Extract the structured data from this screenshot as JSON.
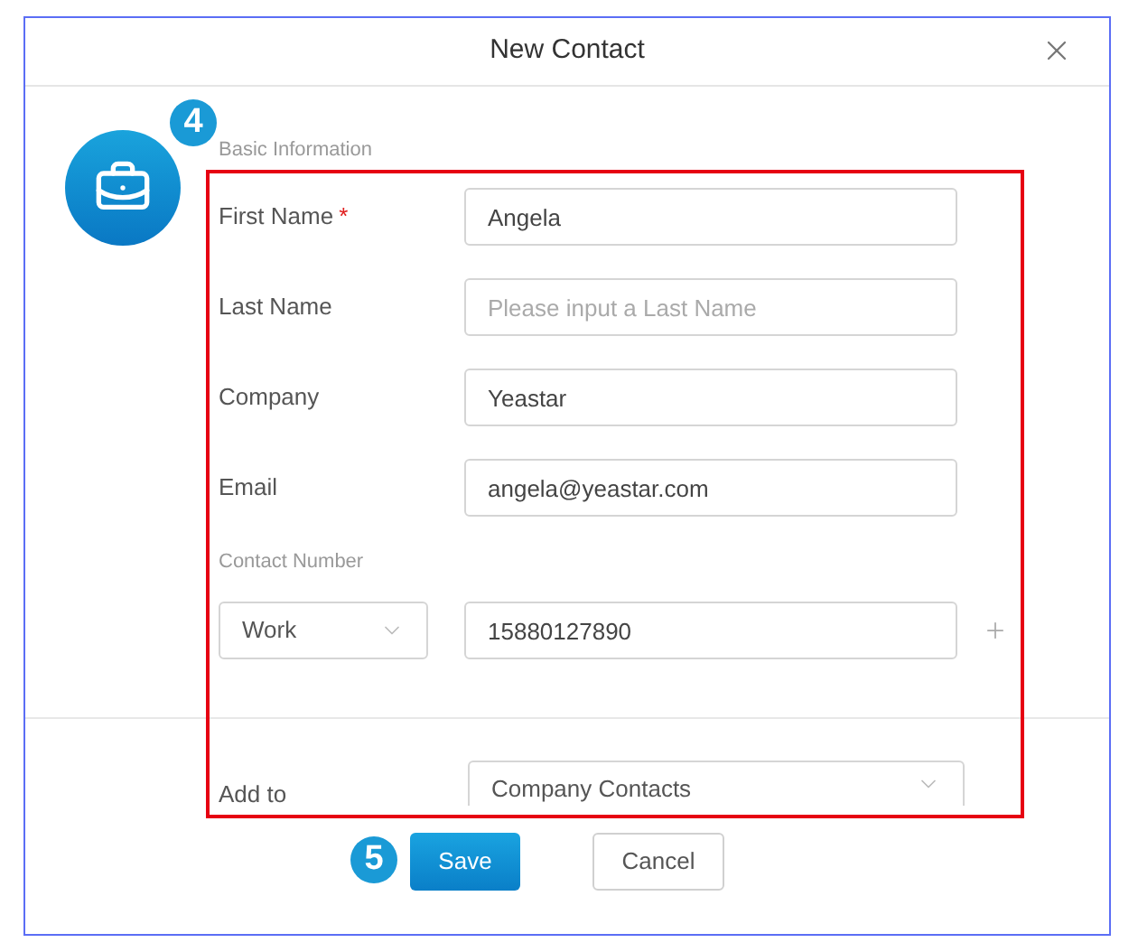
{
  "window": {
    "title": "New Contact"
  },
  "step_badges": [
    "4",
    "5"
  ],
  "basic_information": {
    "title": "Basic Information",
    "fields": [
      {
        "label": "First Name",
        "required_mark": "*",
        "value": "Angela"
      },
      {
        "label": "Last Name",
        "placeholder": "Please input a Last Name"
      },
      {
        "label": "Company",
        "value": "Yeastar"
      },
      {
        "label": "Email",
        "value": "angela@yeastar.com"
      }
    ]
  },
  "contact_number": {
    "title": "Contact Number",
    "type": "Work",
    "number": "15880127890"
  },
  "add_to": {
    "label": "Add to",
    "value": "Company Contacts"
  },
  "buttons": [
    {
      "label": "Save",
      "kind": "primary"
    },
    {
      "label": "Cancel",
      "kind": "secondary"
    }
  ]
}
